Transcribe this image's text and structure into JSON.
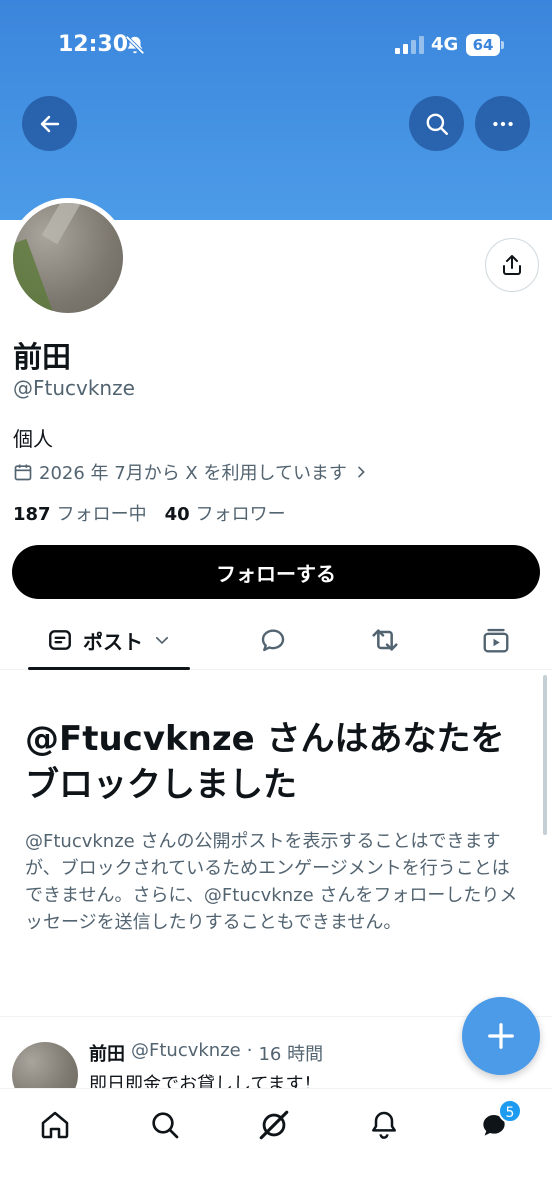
{
  "status_bar": {
    "time": "12:30",
    "network": "4G",
    "battery": "64"
  },
  "profile": {
    "name": "前田",
    "handle": "@Ftucvknze",
    "bio": "個人",
    "joined": "2026 年 7月から X を利用しています",
    "following_count": "187",
    "following_label": "フォロー中",
    "followers_count": "40",
    "followers_label": "フォロワー",
    "follow_button": "フォローする"
  },
  "tabs": [
    {
      "label": "ポスト",
      "icon": "posts-icon",
      "active": true
    },
    {
      "label": "",
      "icon": "replies-icon"
    },
    {
      "label": "",
      "icon": "retweet-icon"
    },
    {
      "label": "",
      "icon": "media-icon"
    }
  ],
  "blocked_notice": {
    "title": "@Ftucvknze さんはあなたをブロックしました",
    "description": "@Ftucvknze さんの公開ポストを表示することはできますが、ブロックされているためエンゲージメントを行うことはできません。さらに、@Ftucvknze さんをフォローしたりメッセージを送信したりすることもできません。"
  },
  "post": {
    "name": "前田",
    "handle": "@Ftucvknze",
    "separator": "·",
    "time": "16 時間",
    "text": "即日即金でお貸ししてます！"
  },
  "nav": {
    "messages_badge": "5"
  },
  "colors": {
    "banner": "#4c9be8",
    "accent": "#1d9bf0",
    "fab": "#4c9be8"
  }
}
